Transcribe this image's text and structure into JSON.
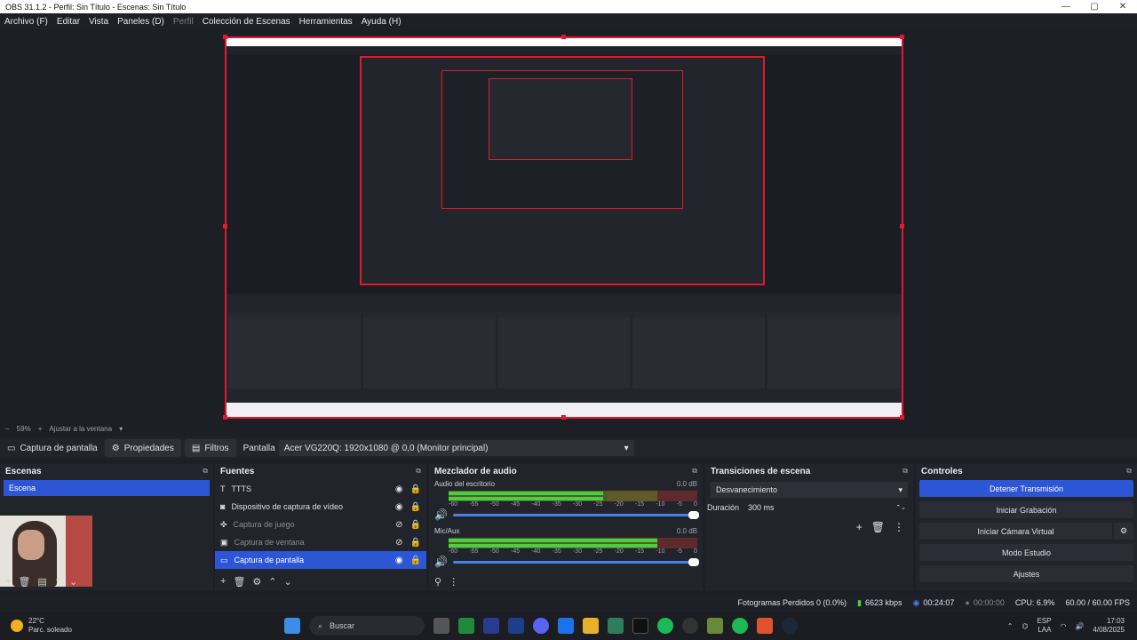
{
  "window": {
    "title": "OBS 31.1.2 - Perfil: Sin Título - Escenas: Sin Título",
    "controls": [
      "—",
      "▢",
      "✕"
    ]
  },
  "menu": [
    {
      "label": "Archivo (F)",
      "dim": false
    },
    {
      "label": "Editar",
      "dim": false
    },
    {
      "label": "Vista",
      "dim": false
    },
    {
      "label": "Paneles (D)",
      "dim": false
    },
    {
      "label": "Perfil",
      "dim": true
    },
    {
      "label": "Colección de Escenas",
      "dim": false
    },
    {
      "label": "Herramientas",
      "dim": false
    },
    {
      "label": "Ayuda (H)",
      "dim": false
    }
  ],
  "zoom": {
    "minus": "−",
    "value": "59%",
    "plus": "+",
    "fit": "Ajustar a la ventana"
  },
  "source_bar": {
    "current": "Captura de pantalla",
    "properties": "Propiedades",
    "filters": "Filtros",
    "display_label": "Pantalla",
    "display_value": "Acer VG220Q: 1920x1080 @ 0,0 (Monitor principal)"
  },
  "scenes": {
    "title": "Escenas",
    "items": [
      "Escena"
    ]
  },
  "sources": {
    "title": "Fuentes",
    "items": [
      {
        "name": "TTTS",
        "dim": false,
        "selected": false
      },
      {
        "name": "Dispositivo de captura de vídeo",
        "dim": false,
        "selected": false
      },
      {
        "name": "Captura de juego",
        "dim": true,
        "selected": false
      },
      {
        "name": "Captura de ventana",
        "dim": true,
        "selected": false
      },
      {
        "name": "Captura de pantalla",
        "dim": false,
        "selected": true
      }
    ]
  },
  "mixer": {
    "title": "Mezclador de audio",
    "ticks": [
      "-60",
      "-55",
      "-50",
      "-45",
      "-40",
      "-35",
      "-30",
      "-25",
      "-20",
      "-15",
      "-10",
      "-5",
      "0"
    ],
    "channels": [
      {
        "name": "Audio del escritorio",
        "db": "0.0 dB",
        "level": 0.62
      },
      {
        "name": "Mic/Aux",
        "db": "0.0 dB",
        "level": 0.84
      }
    ]
  },
  "transitions": {
    "title": "Transiciones de escena",
    "type": "Desvanecimiento",
    "duration_label": "Duración",
    "duration_value": "300 ms"
  },
  "controls": {
    "title": "Controles",
    "buttons": [
      "Detener Transmisión",
      "Iniciar Grabación",
      "Iniciar Cámara Virtual",
      "Modo Estudio",
      "Ajustes"
    ]
  },
  "status": {
    "dropped": "Fotogramas Perdidos 0 (0.0%)",
    "bitrate": "6623 kbps",
    "stream_time": "00:24:07",
    "rec_time": "00:00:00",
    "cpu": "CPU: 6.9%",
    "fps": "60.00 / 60.00 FPS"
  },
  "taskbar": {
    "weather_temp": "22°C",
    "weather_desc": "Parc. soleado",
    "search": "Buscar",
    "lang1": "ESP",
    "lang2": "LAA",
    "time": "17:03",
    "date": "4/08/2025"
  },
  "colors": {
    "accent": "#2c56d6",
    "canvas_border": "#e0192e",
    "meter_green": "#4ccf3e",
    "meter_yellow": "#d9b335",
    "meter_red": "#d64141"
  }
}
